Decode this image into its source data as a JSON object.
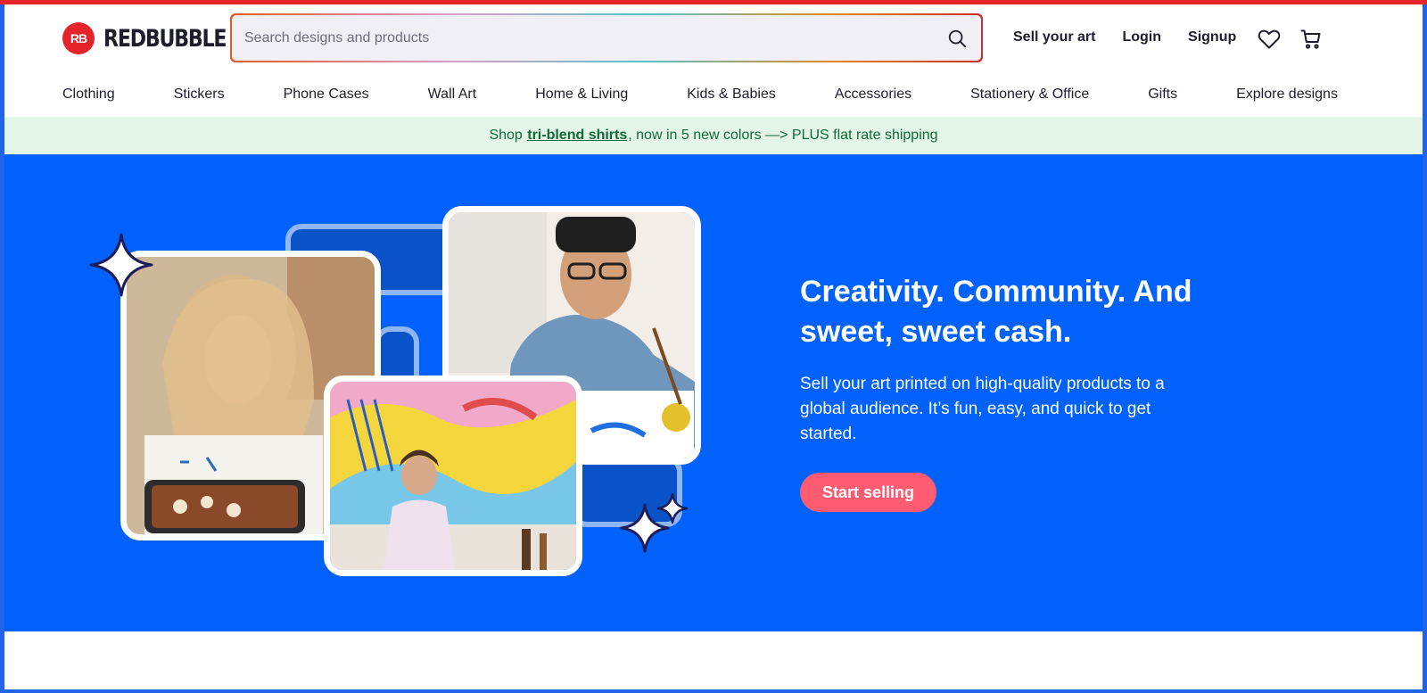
{
  "brand": {
    "name": "REDBUBBLE",
    "mark": "RB",
    "color": "#e4232b"
  },
  "search": {
    "placeholder": "Search designs and products",
    "value": ""
  },
  "header_links": {
    "sell": "Sell your art",
    "login": "Login",
    "signup": "Signup"
  },
  "icons": {
    "search": "search-icon",
    "wishlist": "heart-icon",
    "cart": "cart-icon"
  },
  "nav": {
    "items": [
      "Clothing",
      "Stickers",
      "Phone Cases",
      "Wall Art",
      "Home & Living",
      "Kids & Babies",
      "Accessories",
      "Stationery & Office",
      "Gifts",
      "Explore designs"
    ]
  },
  "promo": {
    "prefix": "Shop ",
    "link": "tri-blend shirts",
    "suffix": ", now in 5 new colors —> PLUS flat rate shipping",
    "bg": "#e3f5e6",
    "color": "#0f6b3a"
  },
  "hero": {
    "title": "Creativity. Community. And sweet, sweet cash.",
    "body": "Sell your art printed on high-quality products to a global audience. It’s fun, easy, and quick to get started.",
    "cta": "Start selling",
    "bg": "#0062fb",
    "cta_color": "#ff5b71"
  }
}
